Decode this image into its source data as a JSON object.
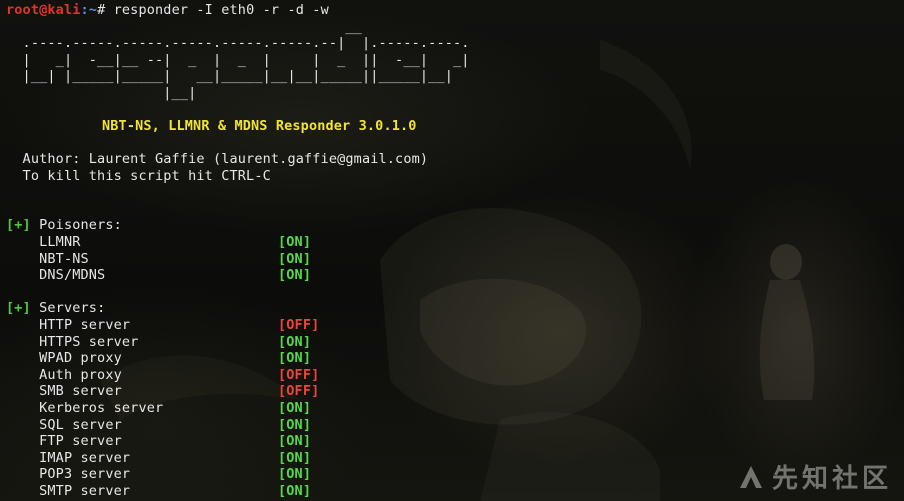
{
  "terminal": {
    "prompt_user": "root@kali",
    "prompt_path": ":~",
    "prompt_symbol": "#",
    "command": " responder -I eth0 -r -d -w",
    "ascii_banner": [
      "                                         __",
      "  .----.-----.-----.-----.-----.-----.--|  |.-----.----.",
      "  |   _|  -__|__ --|  _  |  _  |     |  _  ||  -__|   _|",
      "  |__| |_____|_____|   __|_____|__|__|_____||_____|__|",
      "                   |__|"
    ],
    "title": "NBT-NS, LLMNR & MDNS Responder 3.0.1.0",
    "author": "  Author: Laurent Gaffie (laurent.gaffie@gmail.com)",
    "kill_hint": "  To kill this script hit CTRL-C",
    "section_marker": "[+]",
    "poisoners_header": " Poisoners:",
    "poisoners": [
      {
        "name": "    LLMNR",
        "status": "[ON]",
        "on": true
      },
      {
        "name": "    NBT-NS",
        "status": "[ON]",
        "on": true
      },
      {
        "name": "    DNS/MDNS",
        "status": "[ON]",
        "on": true
      }
    ],
    "servers_header": " Servers:",
    "servers": [
      {
        "name": "    HTTP server",
        "status": "[OFF]",
        "on": false
      },
      {
        "name": "    HTTPS server",
        "status": "[ON]",
        "on": true
      },
      {
        "name": "    WPAD proxy",
        "status": "[ON]",
        "on": true
      },
      {
        "name": "    Auth proxy",
        "status": "[OFF]",
        "on": false
      },
      {
        "name": "    SMB server",
        "status": "[OFF]",
        "on": false
      },
      {
        "name": "    Kerberos server",
        "status": "[ON]",
        "on": true
      },
      {
        "name": "    SQL server",
        "status": "[ON]",
        "on": true
      },
      {
        "name": "    FTP server",
        "status": "[ON]",
        "on": true
      },
      {
        "name": "    IMAP server",
        "status": "[ON]",
        "on": true
      },
      {
        "name": "    POP3 server",
        "status": "[ON]",
        "on": true
      },
      {
        "name": "    SMTP server",
        "status": "[ON]",
        "on": true
      }
    ]
  },
  "watermark": {
    "text": "先知社区",
    "icon": "xianzhi-logo-icon"
  },
  "colors": {
    "prompt_user": "#e0352b",
    "prompt_path": "#5c8ce8",
    "title": "#f2e433",
    "on": "#55d84a",
    "off": "#f0433a",
    "text": "#e6e6e6"
  }
}
